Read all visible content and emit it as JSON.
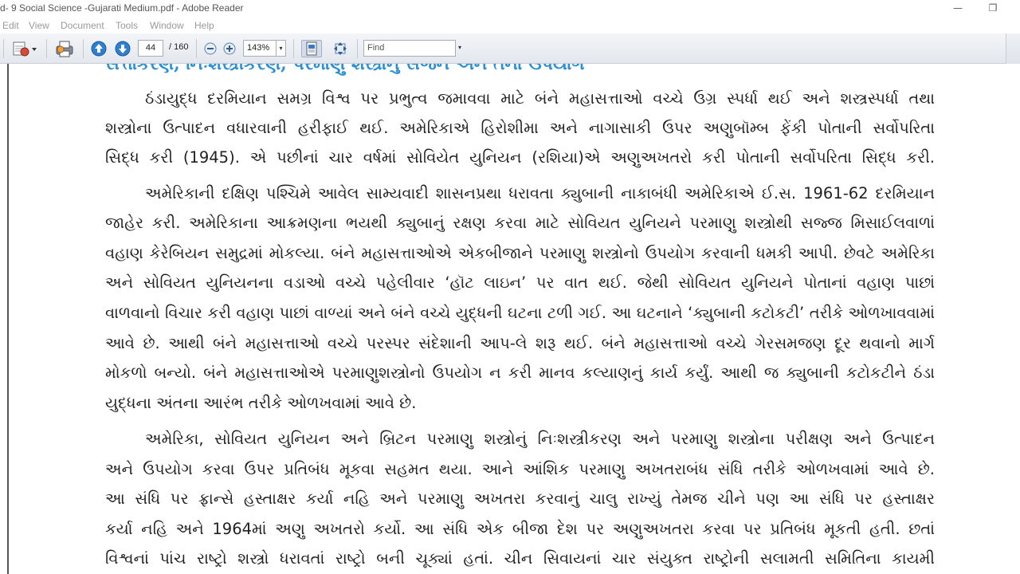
{
  "window": {
    "title": "d- 9 Social Science -Gujarati Medium.pdf - Adobe Reader",
    "minimize_glyph": "—",
    "restore_glyph": "❐"
  },
  "menu": [
    "Edit",
    "View",
    "Document",
    "Tools",
    "Window",
    "Help"
  ],
  "toolbar": {
    "current_page": "44",
    "total_pages": "/ 160",
    "zoom": "143%",
    "find_placeholder": "Find"
  },
  "document": {
    "heading": "સત્તાકરણ, નિઃશસ્ત્રીકરણ, પરમાણુ શસ્ત્રોનું સર્જન અને તેના ઉપયોગ",
    "lines": [
      "ઠંડાયુદ્ધ દરમિયાન સમગ્ર વિશ્વ પર પ્રભુત્વ જમાવવા માટે બંને મહાસત્તાઓ વચ્ચે ઉગ્ર સ્પર્ધા થઈ અને શસ્ત્રસ્પર્ધા તથા",
      "શસ્ત્રોના ઉત્પાદન વધારવાની હરીફાઈ થઈ. અમેરિકાએ હિરોશીમા અને નાગાસાકી ઉપર અણુબૉમ્બ ફેંકી પોતાની સર્વોપરિતા",
      "સિદ્ધ કરી (1945). એ પછીનાં ચાર વર્ષમાં સોવિયેત યુનિયન (રશિયા)એ અણુઅખતરો કરી પોતાની સર્વોપરિતા સિદ્ધ કરી.",
      "અમેરિકાની દક્ષિણ પશ્ચિમે આવેલ સામ્યવાદી શાસનપ્રથા ધરાવતા ક્યુબાની નાકાબંધી અમેરિકાએ ઈ.સ. 1961-62 દરમિયાન",
      "જાહેર કરી. અમેરિકાના આક્રમણના ભયથી ક્યુબાનું રક્ષણ કરવા માટે સોવિયત યુનિયને પરમાણુ શસ્ત્રોથી સજ્જ મિસાઈલવાળાં",
      "વહાણ કેરેબિયન સમુદ્રમાં મોકલ્યા. બંને મહાસત્તાઓએ એકબીજાને પરમાણુ શસ્ત્રોનો ઉપયોગ કરવાની ધમકી આપી. છેવટે અમેરિકા",
      "અને સોવિયત યુનિયનના વડાઓ વચ્ચે પહેલીવાર ‘હૉટ લાઇન’ પર વાત થઈ. જેથી સોવિયત યુનિયને પોતાનાં વહાણ પાછાં",
      "વાળવાનો વિચાર કરી વહાણ પાછાં વાળ્યાં અને બંને વચ્ચે યુદ્ધની ઘટના ટળી ગઈ. આ ઘટનાને ‘ક્યુબાની કટોકટી’ તરીકે ઓળખાવવામાં",
      "આવે છે. આથી બંને મહાસત્તાઓ વચ્ચે પરસ્પર સંદેશાની આપ-લે શરૂ થઈ. બંને મહાસત્તાઓ વચ્ચે ગેરસમજણ દૂર થવાનો માર્ગ",
      "મોકળો બન્યો. બંને મહાસત્તાઓએ પરમાણુશસ્ત્રોનો ઉપયોગ ન કરી માનવ કલ્યાણનું કાર્ય કર્યું. આથી જ ક્યુબાની કટોકટીને ઠંડા",
      "યુદ્ધના અંતના આરંભ તરીકે ઓળખવામાં આવે છે.",
      "અમેરિકા, સોવિયત યુનિયન અને બ્રિટન પરમાણુ શસ્ત્રોનું નિઃશસ્ત્રીકરણ અને પરમાણુ શસ્ત્રોના પરીક્ષણ અને ઉત્પાદન",
      "અને ઉપયોગ કરવા ઉપર પ્રતિબંધ મૂકવા સહમત થયા. આને આંશિક પરમાણુ અખતરાબંધ સંધિ તરીકે ઓળખવામાં આવે છે.",
      "આ સંધિ પર ફ્રાન્સે હસ્તાક્ષર કર્યા નહિ અને પરમાણુ અખતરા કરવાનું ચાલુ રાખ્યું તેમજ ચીને પણ આ સંધિ પર હસ્તાક્ષર",
      "કર્યા નહિ અને 1964માં અણુ અખતરો કર્યો. આ સંધિ એક બીજા દેશ પર અણુઅખતરા કરવા પર પ્રતિબંધ મૂકતી હતી. છતાં",
      "વિશ્વનાં પાંચ રાષ્ટ્રો શસ્ત્રો ધરાવતાં રાષ્ટ્રો બની ચૂક્યાં હતાં. ચીન સિવાયનાં ચાર સંયુક્ત રાષ્ટ્રોની સલામતી સમિતિના કાયમી"
    ]
  }
}
